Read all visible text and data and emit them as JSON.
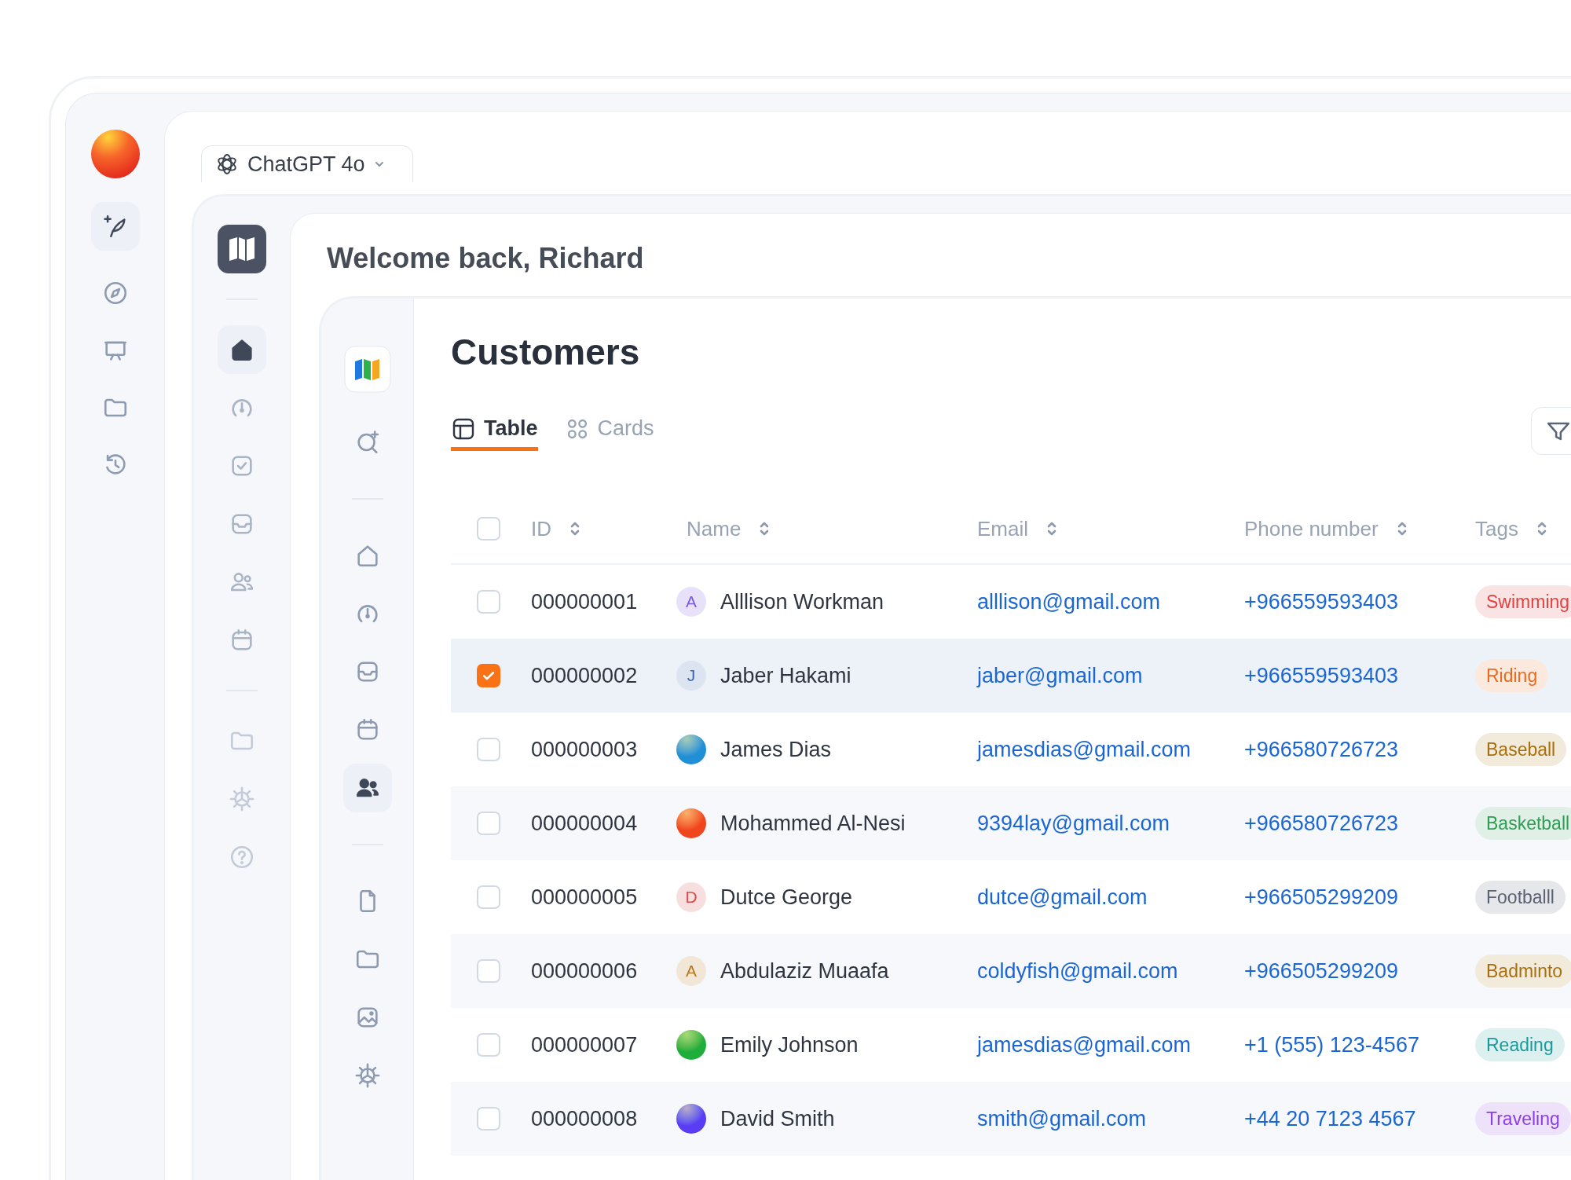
{
  "app_rail": {
    "items": [
      {
        "selected": true
      },
      {
        "selected": false
      },
      {
        "selected": false
      },
      {
        "selected": false
      },
      {
        "selected": false
      }
    ]
  },
  "model_selector": {
    "label": "ChatGPT 4o"
  },
  "greeting": "Welcome back, Richard",
  "nav_rail": {
    "groups": [
      {
        "items": [
          {
            "selected": true
          },
          {
            "selected": false
          },
          {
            "selected": false
          },
          {
            "selected": false
          },
          {
            "selected": false
          },
          {
            "selected": false
          }
        ]
      },
      {
        "items": [
          {
            "selected": false
          },
          {
            "selected": false
          },
          {
            "selected": false
          }
        ]
      }
    ]
  },
  "section_rail": {
    "groups": [
      {
        "items": [
          {
            "selected": false
          }
        ]
      },
      {
        "items": [
          {
            "selected": false
          },
          {
            "selected": false
          },
          {
            "selected": false
          },
          {
            "selected": false
          },
          {
            "selected": true
          }
        ]
      },
      {
        "items": [
          {
            "selected": false
          },
          {
            "selected": false
          },
          {
            "selected": false
          },
          {
            "selected": false
          }
        ]
      }
    ]
  },
  "page_title": "Customers",
  "view_tabs": [
    {
      "label": "Table",
      "selected": true
    },
    {
      "label": "Cards",
      "selected": false
    }
  ],
  "table": {
    "all_checked": false,
    "columns": [
      "ID",
      "Name",
      "Email",
      "Phone number",
      "Tags"
    ],
    "rows": [
      {
        "checked": false,
        "id": "000000001",
        "avatar": {
          "kind": "letter",
          "letter": "A",
          "color": "#7c5ce0"
        },
        "name": "Alllison Workman",
        "email": "alllison@gmail.com",
        "phone": "+966559593403",
        "tag": {
          "label": "Swimming",
          "color": "#e04343"
        }
      },
      {
        "checked": true,
        "id": "000000002",
        "avatar": {
          "kind": "letter",
          "letter": "J",
          "color": "#3b64b0"
        },
        "name": "Jaber Hakami",
        "email": "jaber@gmail.com",
        "phone": "+966559593403",
        "tag": {
          "label": "Riding",
          "color": "#ea6a1f"
        }
      },
      {
        "checked": false,
        "id": "000000003",
        "avatar": {
          "kind": "gradient",
          "color": "#1f8fd6"
        },
        "name": "James Dias",
        "email": "jamesdias@gmail.com",
        "phone": "+966580726723",
        "tag": {
          "label": "Baseball",
          "color": "#a8700c"
        }
      },
      {
        "checked": false,
        "id": "000000004",
        "avatar": {
          "kind": "gradient",
          "color": "#f0461e"
        },
        "name": "Mohammed Al-Nesi",
        "email": "9394lay@gmail.com",
        "phone": "+966580726723",
        "tag": {
          "label": "Basketball",
          "color": "#2f9e55"
        }
      },
      {
        "checked": false,
        "id": "000000005",
        "avatar": {
          "kind": "letter",
          "letter": "D",
          "color": "#d84b4b"
        },
        "name": "Dutce George",
        "email": "dutce@gmail.com",
        "phone": "+966505299209",
        "tag": {
          "label": "Footballl",
          "color": "#5b6272"
        }
      },
      {
        "checked": false,
        "id": "000000006",
        "avatar": {
          "kind": "letter",
          "letter": "A",
          "color": "#b7791f"
        },
        "name": "Abdulaziz Muaafa",
        "email": "coldyfish@gmail.com",
        "phone": "+966505299209",
        "tag": {
          "label": "Badminto",
          "color": "#a8700c"
        }
      },
      {
        "checked": false,
        "id": "000000007",
        "avatar": {
          "kind": "gradient",
          "color": "#1fae3c"
        },
        "name": "Emily Johnson",
        "email": "jamesdias@gmail.com",
        "phone": "+1 (555) 123-4567",
        "tag": {
          "label": "Reading",
          "color": "#1b9a9a"
        }
      },
      {
        "checked": false,
        "id": "000000008",
        "avatar": {
          "kind": "gradient",
          "color": "#5b3cf5"
        },
        "name": "David Smith",
        "email": "smith@gmail.com",
        "phone": "+44 20 7123 4567",
        "tag": {
          "label": "Traveling",
          "color": "#8b3fe0"
        }
      }
    ]
  }
}
